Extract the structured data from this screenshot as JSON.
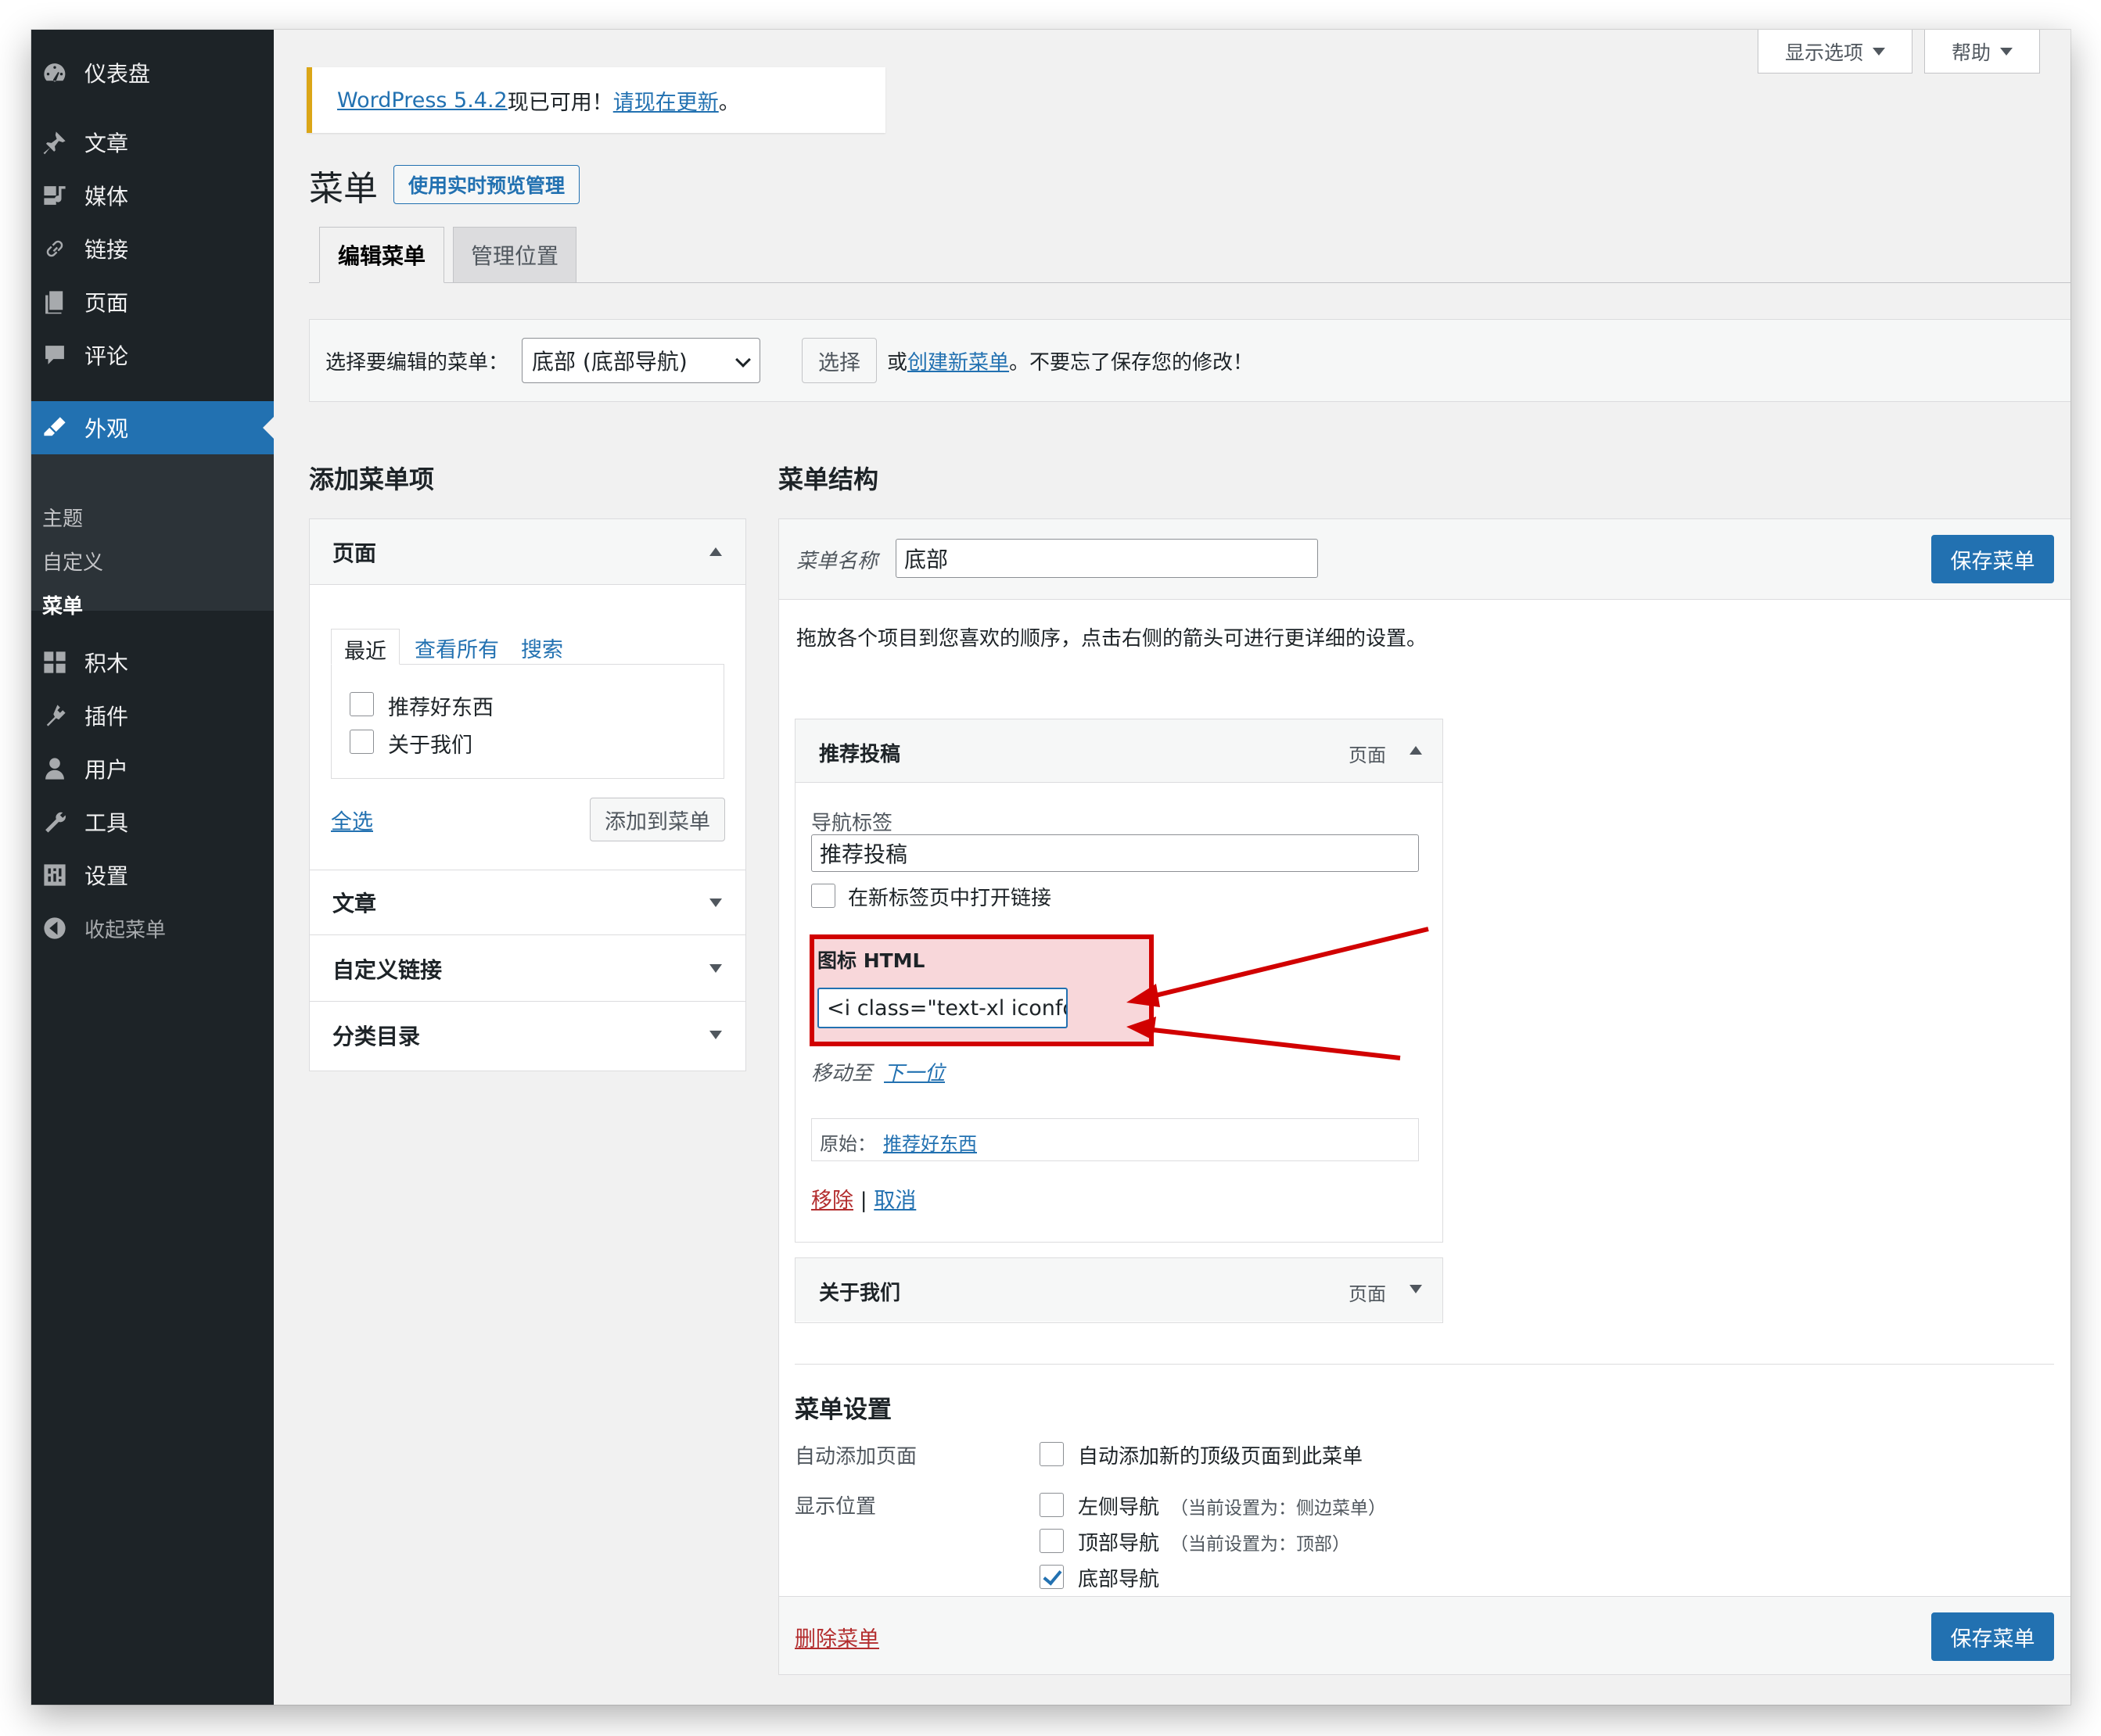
{
  "sidebar": {
    "items": [
      {
        "label": "仪表盘",
        "icon": "dashboard-icon"
      },
      {
        "label": "文章",
        "icon": "pin-icon"
      },
      {
        "label": "媒体",
        "icon": "media-icon"
      },
      {
        "label": "链接",
        "icon": "link-icon"
      },
      {
        "label": "页面",
        "icon": "page-icon"
      },
      {
        "label": "评论",
        "icon": "comment-icon"
      },
      {
        "label": "外观",
        "icon": "brush-icon"
      },
      {
        "label": "积木",
        "icon": "blocks-icon"
      },
      {
        "label": "插件",
        "icon": "plugin-icon"
      },
      {
        "label": "用户",
        "icon": "user-icon"
      },
      {
        "label": "工具",
        "icon": "wrench-icon"
      },
      {
        "label": "设置",
        "icon": "settings-icon"
      },
      {
        "label": "收起菜单",
        "icon": "collapse-icon"
      }
    ],
    "submenu": [
      "主题",
      "自定义",
      "菜单"
    ]
  },
  "screen_meta": {
    "options": "显示选项",
    "help": "帮助"
  },
  "notice": {
    "link": "WordPress 5.4.2",
    "text": "现已可用！",
    "update_link": "请现在更新",
    "end": "。"
  },
  "header": {
    "title": "菜单",
    "live_preview": "使用实时预览管理"
  },
  "tabs": [
    {
      "label": "编辑菜单"
    },
    {
      "label": "管理位置"
    }
  ],
  "select_bar": {
    "label": "选择要编辑的菜单：",
    "selected": "底部 (底部导航)",
    "select_button": "选择",
    "or": "或",
    "create_link": "创建新菜单",
    "reminder": "。不要忘了保存您的修改！"
  },
  "add_items": {
    "heading": "添加菜单项",
    "pages": {
      "title": "页面",
      "tabs": [
        "最近",
        "查看所有",
        "搜索"
      ],
      "items": [
        "推荐好东西",
        "关于我们"
      ],
      "select_all": "全选",
      "add_button": "添加到菜单"
    },
    "sections": [
      "文章",
      "自定义链接",
      "分类目录"
    ]
  },
  "structure": {
    "heading": "菜单结构",
    "name_label": "菜单名称",
    "name_value": "底部",
    "save": "保存菜单",
    "instructions": "拖放各个项目到您喜欢的顺序，点击右侧的箭头可进行更详细的设置。",
    "item1": {
      "title": "推荐投稿",
      "type": "页面",
      "nav_label": "导航标签",
      "nav_value": "推荐投稿",
      "new_tab": "在新标签页中打开链接",
      "icon_label": "图标 HTML",
      "icon_value": "<i class=\"text-xl iconfo",
      "move_label": "移动至",
      "move_link": "下一位",
      "original_label": "原始：",
      "original_link": "推荐好东西",
      "remove": "移除",
      "sep": "|",
      "cancel": "取消"
    },
    "item2": {
      "title": "关于我们",
      "type": "页面"
    },
    "settings": {
      "heading": "菜单设置",
      "auto_add_label": "自动添加页面",
      "auto_add_option": "自动添加新的顶级页面到此菜单",
      "location_label": "显示位置",
      "locations": [
        {
          "name": "左侧导航",
          "note": "（当前设置为：侧边菜单）",
          "checked": false
        },
        {
          "name": "顶部导航",
          "note": "（当前设置为：顶部）",
          "checked": false
        },
        {
          "name": "底部导航",
          "note": "",
          "checked": true
        }
      ]
    },
    "delete": "删除菜单"
  },
  "colors": {
    "accent": "#2271b1",
    "sidebar": "#1d2327",
    "highlight": "#d10000",
    "notice": "#dba617"
  }
}
